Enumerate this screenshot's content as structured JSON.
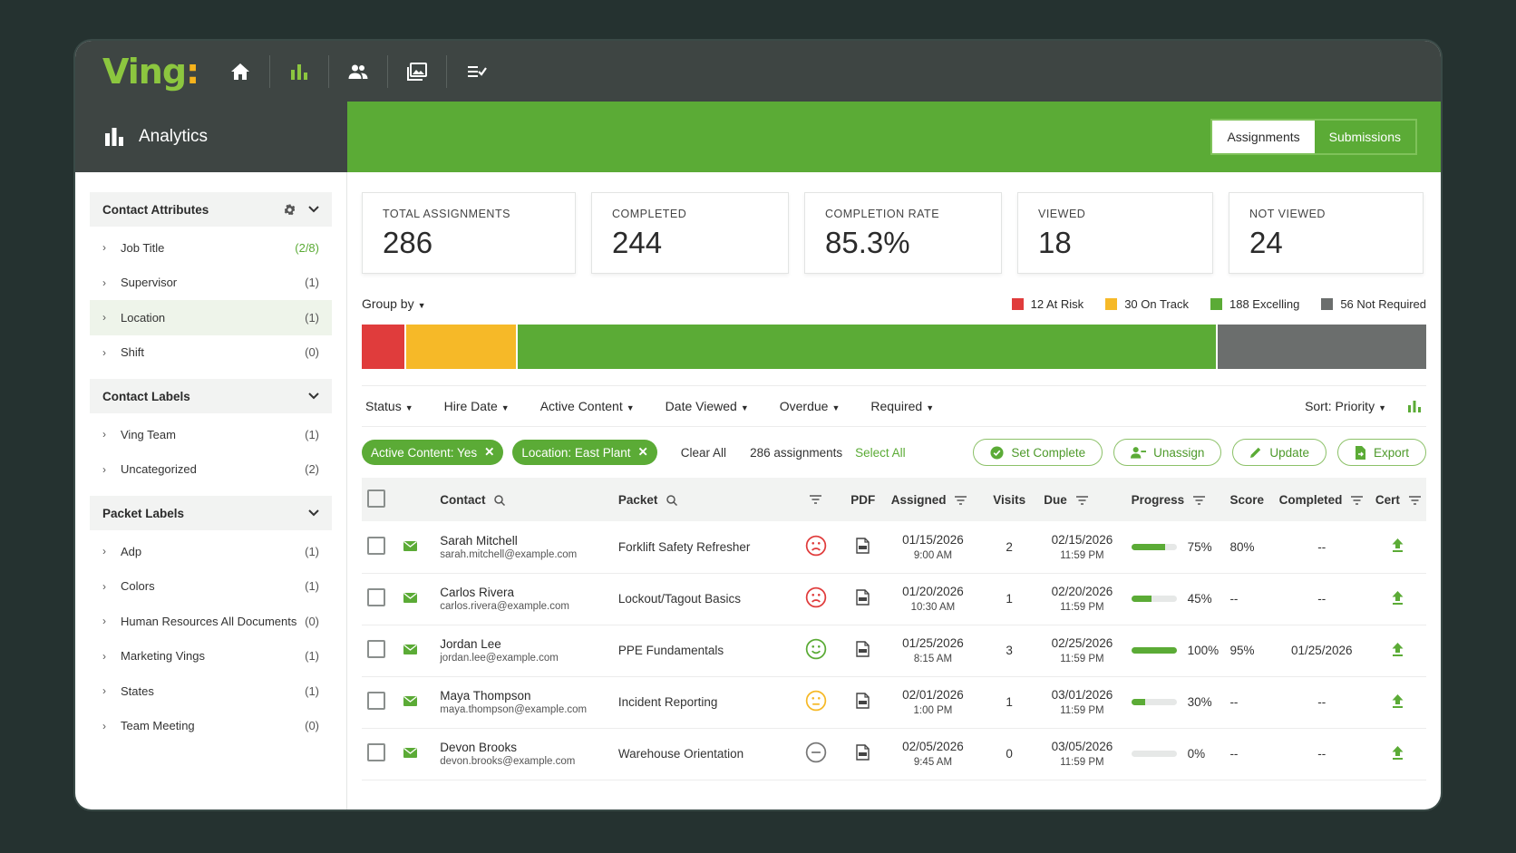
{
  "app": {
    "logo": "Ving",
    "logo_dot": ":"
  },
  "nav": {
    "icons": [
      "home-icon",
      "bar-chart-icon",
      "people-icon",
      "gallery-icon",
      "checklist-icon"
    ]
  },
  "header": {
    "title": "Analytics",
    "tabs": [
      "Assignments",
      "Submissions"
    ],
    "active_tab": "Assignments"
  },
  "sidebar": {
    "contact_attributes": {
      "title": "Contact Attributes",
      "items": [
        {
          "label": "Job Title",
          "count": "(2/8)"
        },
        {
          "label": "Supervisor",
          "count": "(1)"
        },
        {
          "label": "Location",
          "count": "(1)"
        },
        {
          "label": "Shift",
          "count": "(0)"
        }
      ]
    },
    "contact_labels": {
      "title": "Contact Labels",
      "items": [
        {
          "label": "Ving Team",
          "count": "(1)"
        },
        {
          "label": "Uncategorized",
          "count": "(2)"
        }
      ]
    },
    "packet_labels": {
      "title": "Packet Labels",
      "items": [
        {
          "label": "Adp",
          "count": "(1)"
        },
        {
          "label": "Colors",
          "count": "(1)"
        },
        {
          "label": "Human Resources All Documents",
          "count": "(0)"
        },
        {
          "label": "Marketing Vings",
          "count": "(1)"
        },
        {
          "label": "States",
          "count": "(1)"
        },
        {
          "label": "Team Meeting",
          "count": "(0)"
        }
      ]
    }
  },
  "stats": [
    {
      "title": "Total Assignments",
      "value": "286"
    },
    {
      "title": "Completed",
      "value": "244"
    },
    {
      "title": "Completion Rate",
      "value": "85.3%"
    },
    {
      "title": "Viewed",
      "value": "18"
    },
    {
      "title": "Not Viewed",
      "value": "24"
    }
  ],
  "group_by": "Group by",
  "legend": [
    {
      "label": "12 At Risk",
      "value": 12,
      "color": "#e03c3c"
    },
    {
      "label": "30 On Track",
      "value": 30,
      "color": "#f6b928"
    },
    {
      "label": "188 Excelling",
      "value": 188,
      "color": "#5bab36"
    },
    {
      "label": "56 Not Required",
      "value": 56,
      "color": "#6b6e6d"
    }
  ],
  "filters": [
    "Status",
    "Hire Date",
    "Active Content",
    "Date Viewed",
    "Overdue",
    "Required"
  ],
  "sort": "Sort: Priority",
  "chips": [
    "Active Content: Yes",
    "Location: East Plant"
  ],
  "clear_all": "Clear All",
  "assignment_count": "286 assignments",
  "select_all": "Select All",
  "actions": [
    "Set Complete",
    "Unassign",
    "Update",
    "Export"
  ],
  "table": {
    "headers": {
      "contact": "Contact",
      "packet": "Packet",
      "pdf": "PDF",
      "assigned": "Assigned",
      "visits": "Visits",
      "due": "Due",
      "progress": "Progress",
      "score": "Score",
      "completed": "Completed",
      "cert": "Cert"
    },
    "rows": [
      {
        "name": "Sarah Mitchell",
        "email": "sarah.mitchell@example.com",
        "packet": "Forklift Safety Refresher",
        "mood": "sad",
        "assigned_date": "01/15/2026",
        "assigned_time": "9:00 AM",
        "visits": "2",
        "due_date": "02/15/2026",
        "due_time": "11:59 PM",
        "progress": 75,
        "progress_label": "75%",
        "score": "80%",
        "completed": "--"
      },
      {
        "name": "Carlos Rivera",
        "email": "carlos.rivera@example.com",
        "packet": "Lockout/Tagout Basics",
        "mood": "sad",
        "assigned_date": "01/20/2026",
        "assigned_time": "10:30 AM",
        "visits": "1",
        "due_date": "02/20/2026",
        "due_time": "11:59 PM",
        "progress": 45,
        "progress_label": "45%",
        "score": "--",
        "completed": "--"
      },
      {
        "name": "Jordan Lee",
        "email": "jordan.lee@example.com",
        "packet": "PPE Fundamentals",
        "mood": "happy",
        "assigned_date": "01/25/2026",
        "assigned_time": "8:15 AM",
        "visits": "3",
        "due_date": "02/25/2026",
        "due_time": "11:59 PM",
        "progress": 100,
        "progress_label": "100%",
        "score": "95%",
        "completed": "01/25/2026"
      },
      {
        "name": "Maya Thompson",
        "email": "maya.thompson@example.com",
        "packet": "Incident Reporting",
        "mood": "neutral",
        "assigned_date": "02/01/2026",
        "assigned_time": "1:00 PM",
        "visits": "1",
        "due_date": "03/01/2026",
        "due_time": "11:59 PM",
        "progress": 30,
        "progress_label": "30%",
        "score": "--",
        "completed": "--"
      },
      {
        "name": "Devon Brooks",
        "email": "devon.brooks@example.com",
        "packet": "Warehouse Orientation",
        "mood": "none",
        "assigned_date": "02/05/2026",
        "assigned_time": "9:45 AM",
        "visits": "0",
        "due_date": "03/05/2026",
        "due_time": "11:59 PM",
        "progress": 0,
        "progress_label": "0%",
        "score": "--",
        "completed": "--"
      }
    ]
  }
}
